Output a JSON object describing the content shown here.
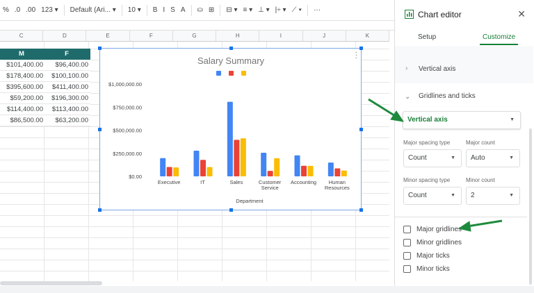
{
  "toolbar": {
    "items": [
      "%",
      ".0",
      ".00",
      "123 ▾",
      "Default (Ari... ▾",
      "10 ▾",
      "B",
      "I",
      "S",
      "A",
      "⛀",
      "⊞",
      "⊟ ▾",
      "≡ ▾",
      "⊥ ▾",
      "|÷ ▾",
      "⟋ ▾",
      "···"
    ]
  },
  "columns": [
    "C",
    "D",
    "E",
    "F",
    "G",
    "H",
    "I",
    "J",
    "K"
  ],
  "table": {
    "headers": [
      "M",
      "F"
    ],
    "rows": [
      [
        "$101,400.00",
        "$96,400.00"
      ],
      [
        "$178,400.00",
        "$100,100.00"
      ],
      [
        "$395,600.00",
        "$411,400.00"
      ],
      [
        "$59,200.00",
        "$196,300.00"
      ],
      [
        "$114,400.00",
        "$113,400.00"
      ],
      [
        "$86,500.00",
        "$63,200.00"
      ]
    ]
  },
  "chart_data": {
    "type": "bar",
    "title": "Salary Summary",
    "xlabel": "Department",
    "ylabel": "",
    "categories": [
      "Executive",
      "IT",
      "Sales",
      "Customer Service",
      "Accounting",
      "Human Resources"
    ],
    "series": [
      {
        "color": "#4285f4",
        "values": [
          197800,
          278500,
          807000,
          255500,
          227800,
          149700
        ]
      },
      {
        "color": "#ea4335",
        "values": [
          101400,
          178400,
          395600,
          59200,
          114400,
          86500
        ]
      },
      {
        "color": "#fbbc04",
        "values": [
          96400,
          100100,
          411400,
          196300,
          113400,
          63200
        ]
      }
    ],
    "ylim": [
      0,
      1000000
    ],
    "yticks": [
      "$0.00",
      "$250,000.00",
      "$500,000.00",
      "$750,000.00",
      "$1,000,000.00"
    ],
    "grid": false,
    "legend": "top"
  },
  "panel": {
    "title": "Chart editor",
    "tabs": [
      "Setup",
      "Customize"
    ],
    "active_tab": "Customize",
    "vertical_axis_section": "Vertical axis",
    "gridlines_section": "Gridlines and ticks",
    "axis_select": "Vertical axis",
    "major_spacing_label": "Major spacing type",
    "major_spacing_value": "Count",
    "major_count_label": "Major count",
    "major_count_value": "Auto",
    "minor_spacing_label": "Minor spacing type",
    "minor_spacing_value": "Count",
    "minor_count_label": "Minor count",
    "minor_count_value": "2",
    "checkboxes": [
      {
        "label": "Major gridlines",
        "checked": false
      },
      {
        "label": "Minor gridlines",
        "checked": false
      },
      {
        "label": "Major ticks",
        "checked": false
      },
      {
        "label": "Minor ticks",
        "checked": false
      }
    ]
  },
  "colors": {
    "accent": "#188038",
    "arrow": "#1e8a3c",
    "header": "#1f6b6b"
  }
}
